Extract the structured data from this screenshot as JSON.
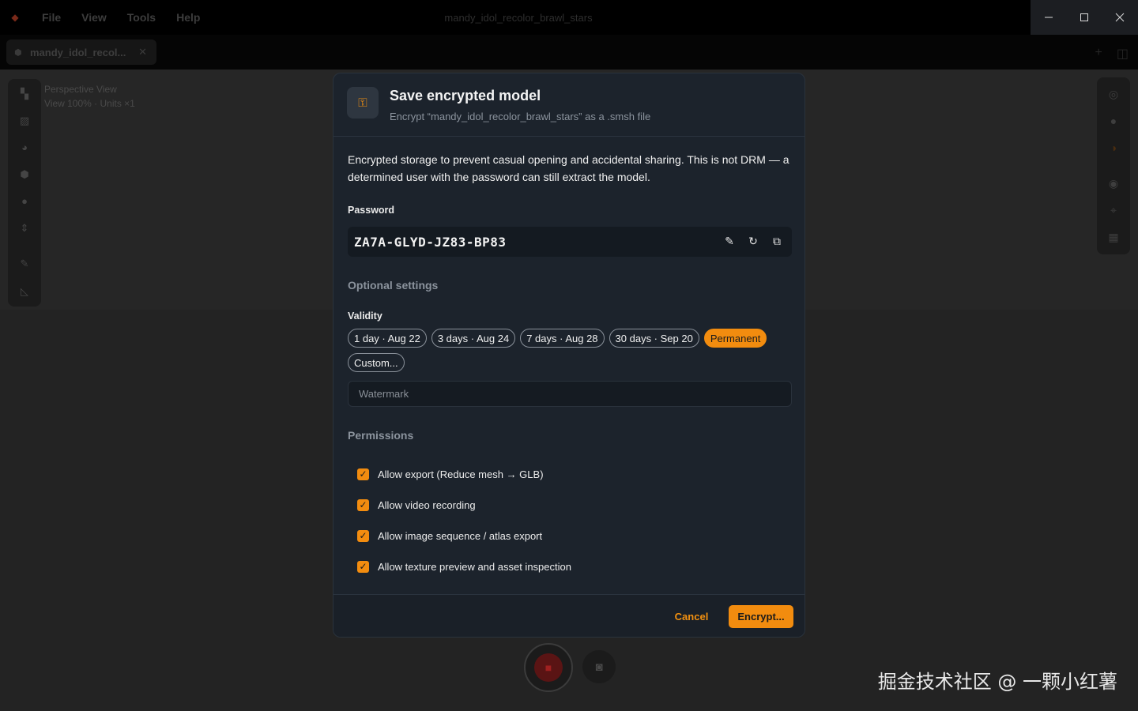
{
  "menu": {
    "file": "File",
    "view": "View",
    "tools": "Tools",
    "help": "Help"
  },
  "window_title": "mandy_idol_recolor_brawl_stars",
  "tab": {
    "label": "mandy_idol_recol..."
  },
  "viewport": {
    "view_name": "Perspective View",
    "view_stats": "View 100% · Units ×1"
  },
  "dialog": {
    "title": "Save encrypted model",
    "subtitle": "Encrypt “mandy_idol_recolor_brawl_stars” as a .smsh file",
    "description": "Encrypted storage to prevent casual opening and accidental sharing. This is not DRM — a determined user with the password can still extract the model.",
    "password_label": "Password",
    "password_value": "ZA7A-GLYD-JZ83-BP83",
    "optional_title": "Optional settings",
    "validity_label": "Validity",
    "validity_options": [
      "1 day · Aug 22",
      "3 days · Aug 24",
      "7 days · Aug 28",
      "30 days · Sep 20",
      "Permanent",
      "Custom..."
    ],
    "validity_selected": "Permanent",
    "watermark_placeholder": "Watermark",
    "permissions_title": "Permissions",
    "permissions": [
      "Allow export (Reduce mesh → GLB)",
      "Allow video recording",
      "Allow image sequence / atlas export",
      "Allow texture preview and asset inspection"
    ],
    "cancel_label": "Cancel",
    "encrypt_label": "Encrypt..."
  },
  "overlay_watermark": "掘金技术社区 @ 一颗小红薯",
  "colors": {
    "accent": "#f28c0f",
    "dialog_bg": "#1c232c"
  }
}
